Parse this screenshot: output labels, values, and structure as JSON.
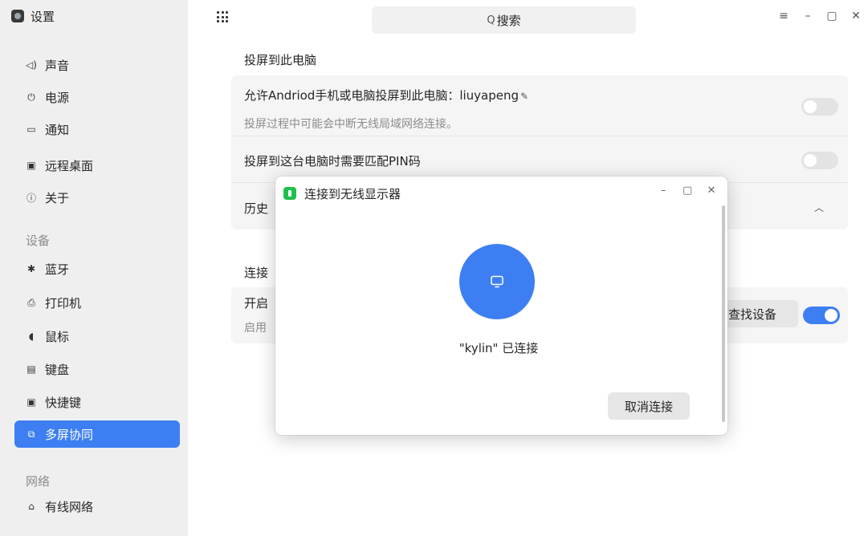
{
  "app": {
    "title": "设置",
    "icon": "settings-app-icon"
  },
  "sidebar": {
    "items": [
      {
        "label": "声音",
        "icon": "speaker-icon"
      },
      {
        "label": "电源",
        "icon": "power-icon"
      },
      {
        "label": "通知",
        "icon": "notification-icon"
      },
      {
        "label": "远程桌面",
        "icon": "remote-desktop-icon"
      },
      {
        "label": "关于",
        "icon": "info-icon"
      }
    ],
    "group_device": "设备",
    "device_items": [
      {
        "label": "蓝牙",
        "icon": "bluetooth-icon"
      },
      {
        "label": "打印机",
        "icon": "printer-icon"
      },
      {
        "label": "鼠标",
        "icon": "mouse-icon"
      },
      {
        "label": "键盘",
        "icon": "keyboard-icon"
      },
      {
        "label": "快捷键",
        "icon": "shortcut-icon"
      },
      {
        "label": "多屏协同",
        "icon": "multi-screen-icon",
        "active": true
      }
    ],
    "group_network": "网络",
    "network_items": [
      {
        "label": "有线网络",
        "icon": "wired-network-icon"
      }
    ]
  },
  "header": {
    "search_placeholder": "搜索"
  },
  "main": {
    "section1_title": "投屏到此电脑",
    "allow_label": "允许Andriod手机或电脑投屏到此电脑：liuyapeng",
    "allow_sub": "投屏过程中可能会中断无线局域网络连接。",
    "pin_label": "投屏到这台电脑时需要匹配PIN码",
    "history_label": "历史",
    "section2_title": "连接",
    "open_label": "开启",
    "enable_label": "启用",
    "find_device_button": "查找设备",
    "toggle_allow_on": false,
    "toggle_pin_on": false,
    "toggle_open_on": true
  },
  "dialog": {
    "title": "连接到无线显示器",
    "status": "\"kylin\" 已连接",
    "cancel_button": "取消连接"
  },
  "colors": {
    "accent": "#3d7ff2",
    "sidebar_bg": "#efefef",
    "card_bg": "#f5f5f5",
    "dialog_icon": "#1fbf4c"
  }
}
